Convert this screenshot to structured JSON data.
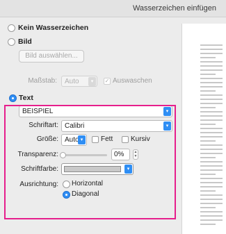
{
  "window": {
    "title": "Wasserzeichen einfügen"
  },
  "no_watermark": {
    "label": "Kein Wasserzeichen",
    "selected": false
  },
  "picture": {
    "label": "Bild",
    "selected": false,
    "choose_button": "Bild auswählen...",
    "scale_label": "Maßstab:",
    "scale_value": "Auto",
    "washout_label": "Auswaschen",
    "washout_checked": true
  },
  "text_section": {
    "label": "Text",
    "selected": true,
    "text_value": "BEISPIEL",
    "font_label": "Schriftart:",
    "font_value": "Calibri",
    "size_label": "Größe:",
    "size_value": "Auto",
    "bold_label": "Fett",
    "bold_checked": false,
    "italic_label": "Kursiv",
    "italic_checked": false,
    "transparency_label": "Transparenz:",
    "transparency_value": "0%",
    "transparency_fraction": 0,
    "font_color_label": "Schriftfarbe:",
    "font_color": "#c9c9c9",
    "orientation_label": "Ausrichtung:",
    "orientation_options": [
      "Horizontal",
      "Diagonal"
    ],
    "orientation_selected": "Diagonal"
  },
  "colors": {
    "accent": "#2f8ef4",
    "highlight_border": "#e61e8c"
  }
}
